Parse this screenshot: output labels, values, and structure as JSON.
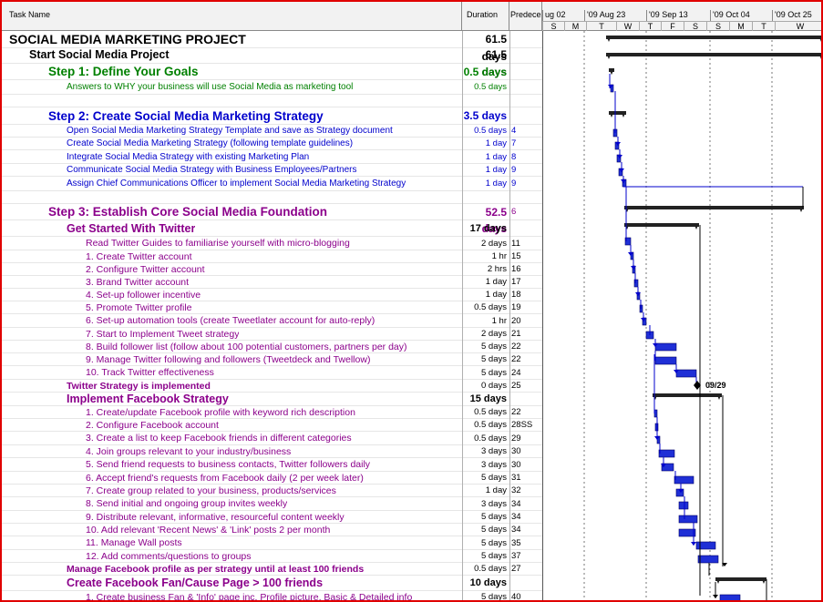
{
  "header": {
    "task_name": "Task Name",
    "duration": "Duration",
    "predecessors": "Predeces",
    "weeks": [
      "ug 02",
      "'09 Aug 23",
      "'09 Sep 13",
      "'09 Oct 04",
      "'09 Oct 25"
    ],
    "days": [
      "S",
      "M",
      "T",
      "W",
      "T",
      "F",
      "S",
      "S",
      "M",
      "T",
      "W"
    ]
  },
  "rows": [
    {
      "name": "SOCIAL MEDIA MARKETING PROJECT",
      "duration": "61.5 days",
      "pred": "",
      "style": "l0"
    },
    {
      "name": "Start Social Media Project",
      "duration": "61.5 days",
      "pred": "",
      "style": "l1"
    },
    {
      "name": "Step 1: Define Your Goals",
      "duration": "0.5 days",
      "pred": "",
      "style": "step green"
    },
    {
      "name": "Answers to WHY your business will use Social Media as marketing tool",
      "duration": "0.5 days",
      "pred": "",
      "style": "t1 green"
    },
    {
      "name": "",
      "duration": "",
      "pred": "",
      "style": "blank"
    },
    {
      "name": "Step 2: Create Social Media Marketing Strategy",
      "duration": "3.5 days",
      "pred": "",
      "style": "step blue"
    },
    {
      "name": "Open Social Media Marketing Strategy Template and save as Strategy document",
      "duration": "0.5 days",
      "pred": "4",
      "style": "t1 blue"
    },
    {
      "name": "Create Social Media Marketing Strategy (following template guidelines)",
      "duration": "1 day",
      "pred": "7",
      "style": "t1 blue"
    },
    {
      "name": "Integrate Social Media Strategy with existing Marketing Plan",
      "duration": "1 day",
      "pred": "8",
      "style": "t1 blue"
    },
    {
      "name": "Communicate Social Media Strategy with Business Employees/Partners",
      "duration": "1 day",
      "pred": "9",
      "style": "t1 blue"
    },
    {
      "name": "Assign Chief Communications Officer to implement Social Media Marketing Strategy",
      "duration": "1 day",
      "pred": "9",
      "style": "t1 blue"
    },
    {
      "name": "",
      "duration": "",
      "pred": "",
      "style": "blank"
    },
    {
      "name": "Step 3: Establish Core Social Media Foundation",
      "duration": "52.5 days",
      "pred": "6",
      "style": "step purple"
    },
    {
      "name": "Get Started With Twitter",
      "duration": "17 days",
      "pred": "",
      "style": "sub"
    },
    {
      "name": "Read Twitter Guides to familiarise yourself with micro-blogging",
      "duration": "2 days",
      "pred": "11",
      "style": "t2"
    },
    {
      "name": "1. Create Twitter account",
      "duration": "1 hr",
      "pred": "15",
      "style": "t2"
    },
    {
      "name": "2. Configure Twitter account",
      "duration": "2 hrs",
      "pred": "16",
      "style": "t2"
    },
    {
      "name": "3. Brand Twitter account",
      "duration": "1 day",
      "pred": "17",
      "style": "t2"
    },
    {
      "name": "4. Set-up follower incentive",
      "duration": "1 day",
      "pred": "18",
      "style": "t2"
    },
    {
      "name": "5. Promote Twitter profile",
      "duration": "0.5 days",
      "pred": "19",
      "style": "t2"
    },
    {
      "name": "6. Set-up automation tools (create Tweetlater account for auto-reply)",
      "duration": "1 hr",
      "pred": "20",
      "style": "t2"
    },
    {
      "name": "7. Start to Implement Tweet strategy",
      "duration": "2 days",
      "pred": "21",
      "style": "t2"
    },
    {
      "name": "8. Build follower list (follow about 100 potential customers, partners per day)",
      "duration": "5 days",
      "pred": "22",
      "style": "t2"
    },
    {
      "name": "9. Manage Twitter following and followers (Tweetdeck and Twellow)",
      "duration": "5 days",
      "pred": "22",
      "style": "t2"
    },
    {
      "name": "10. Track Twitter effectiveness",
      "duration": "5 days",
      "pred": "24",
      "style": "t2"
    },
    {
      "name": "Twitter Strategy is implemented",
      "duration": "0 days",
      "pred": "25",
      "style": "mile"
    },
    {
      "name": "Implement Facebook Strategy",
      "duration": "15 days",
      "pred": "",
      "style": "sub"
    },
    {
      "name": "1. Create/update Facebook profile with keyword rich description",
      "duration": "0.5 days",
      "pred": "22",
      "style": "t2"
    },
    {
      "name": "2. Configure Facebook account",
      "duration": "0.5 days",
      "pred": "28SS",
      "style": "t2"
    },
    {
      "name": "3. Create a list to keep Facebook friends in different categories",
      "duration": "0.5 days",
      "pred": "29",
      "style": "t2"
    },
    {
      "name": "4. Join groups relevant to your industry/business",
      "duration": "3 days",
      "pred": "30",
      "style": "t2"
    },
    {
      "name": "5. Send friend requests to business contacts, Twitter followers daily",
      "duration": "3 days",
      "pred": "30",
      "style": "t2"
    },
    {
      "name": "6. Accept friend's requests from Facebook daily (2 per week later)",
      "duration": "5 days",
      "pred": "31",
      "style": "t2"
    },
    {
      "name": "7. Create group related to your business, products/services",
      "duration": "1 day",
      "pred": "32",
      "style": "t2"
    },
    {
      "name": "8. Send initial and ongoing group invites weekly",
      "duration": "3 days",
      "pred": "34",
      "style": "t2"
    },
    {
      "name": "9. Distribute relevant, informative, resourceful content weekly",
      "duration": "5 days",
      "pred": "34",
      "style": "t2"
    },
    {
      "name": "10. Add relevant 'Recent News' & 'Link' posts 2 per month",
      "duration": "5 days",
      "pred": "34",
      "style": "t2"
    },
    {
      "name": "11. Manage Wall posts",
      "duration": "5 days",
      "pred": "35",
      "style": "t2"
    },
    {
      "name": "12. Add comments/questions to groups",
      "duration": "5 days",
      "pred": "37",
      "style": "t2"
    },
    {
      "name": "Manage Facebook profile as per strategy until at least 100 friends",
      "duration": "0.5 days",
      "pred": "27",
      "style": "mile"
    },
    {
      "name": "Create Facebook Fan/Cause Page > 100 friends",
      "duration": "10 days",
      "pred": "",
      "style": "sub"
    },
    {
      "name": "1. Create business Fan & 'Info' page inc. Profile picture, Basic & Detailed info",
      "duration": "5 days",
      "pred": "40",
      "style": "t2"
    }
  ],
  "milestone_label": "09/29",
  "colors": {
    "frame": "#e00000",
    "bar": "#1f2fd6",
    "summary": "#222222",
    "green": "#008000",
    "blue": "#0000cc",
    "purple": "#8b008b"
  }
}
